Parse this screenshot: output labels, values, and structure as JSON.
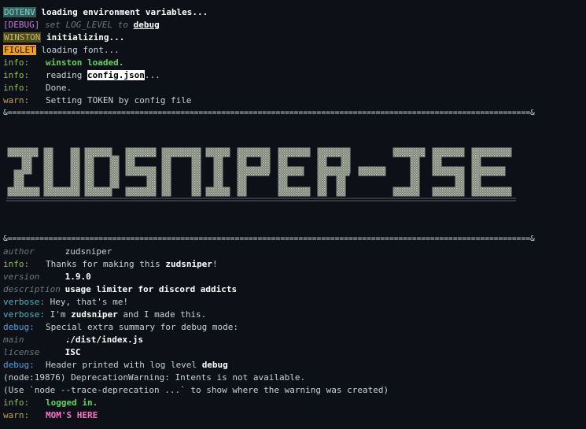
{
  "boot": {
    "dotenv_tag": "DOTENV",
    "dotenv_msg": "loading environment variables...",
    "debug_tag": "[DEBUG]",
    "debug_msg_a": "set LOG_LEVEL to",
    "debug_msg_b": "debug",
    "winston_tag": "WINSTON",
    "winston_msg": "initializing...",
    "figlet_tag": "FIGLET",
    "figlet_msg": "loading font..."
  },
  "log1": [
    {
      "level": "info:",
      "text": "winston loaded."
    },
    {
      "level": "info:",
      "text_a": "reading",
      "text_b": "config.json",
      "text_c": "..."
    },
    {
      "level": "info:",
      "text": "Done."
    },
    {
      "level": "warn:",
      "text": "Setting TOKEN by config file"
    }
  ],
  "separator": "&===================================================================================================================&",
  "banner_text": "ZUDSNIPER",
  "summary": {
    "author_label": "author      :",
    "author_value": "zudsniper",
    "thanks_level": "info:",
    "thanks_a": "Thanks for making this",
    "thanks_b": "zudsniper",
    "thanks_c": "!",
    "version_label": "version     :",
    "version_value": "1.9.0",
    "description_label": "description :",
    "description_value": "usage limiter for discord addicts",
    "verbose1_level": "verbose:",
    "verbose1_text": "Hey, that's me!",
    "verbose2_level": "verbose:",
    "verbose2_a": "I'm",
    "verbose2_b": "zudsniper",
    "verbose2_c": "and I made this.",
    "debug1_level": "debug:",
    "debug1_text": "Special extra summary for debug mode:",
    "main_label": "main        :",
    "main_value": "./dist/index.js",
    "license_label": "license     :",
    "license_value": "ISC",
    "debug2_level": "debug:",
    "debug2_a": "Header printed with log level",
    "debug2_b": "debug",
    "node_warning": "(node:19876) DeprecationWarning: Intents is not available.",
    "node_hint": "(Use `node --trace-deprecation ...` to show where the warning was created)",
    "logged_level": "info:",
    "logged_text": "logged in.",
    "mom_level": "warn:",
    "mom_text": "MOM'S HERE"
  },
  "colors": {
    "background": "#0d1117",
    "info": "#8fbf3f",
    "warn": "#c2a13a",
    "verbose": "#3fbac4",
    "debug": "#4aa3e8",
    "accent_green": "#5fd35f",
    "accent_pink": "#ff6ec7"
  }
}
